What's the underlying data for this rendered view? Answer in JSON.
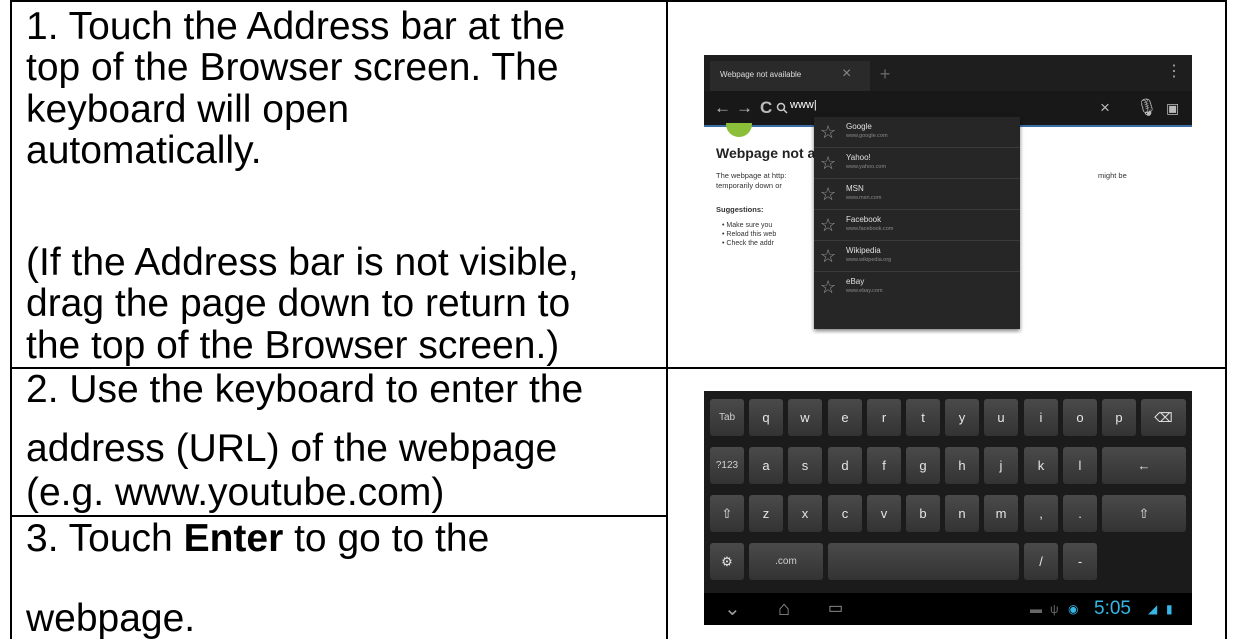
{
  "steps": [
    {
      "lines": [
        "1. Touch the Address bar at the",
        "top of the Browser screen. The",
        "keyboard will open",
        "automatically."
      ],
      "note_lines": [
        "(If the Address bar is not visible,",
        "drag the page down to return to",
        "the top of the Browser screen.)"
      ]
    },
    {
      "lines": [
        "2. Use the keyboard to enter the",
        "address (URL) of the webpage",
        "(e.g. www.youtube.com)"
      ]
    },
    {
      "prefix": "3. Touch ",
      "bold": "Enter",
      "suffix": " to go to the",
      "line2": "webpage."
    }
  ],
  "browser": {
    "tab_title": "Webpage not available",
    "address_value": "www|",
    "page_heading": "Webpage not a",
    "page_text_1": "The webpage at http:",
    "page_text_2": "temporarily down or",
    "page_text_right": "might be",
    "suggestions_label": "Suggestions:",
    "suggestion_bullets": [
      "Make sure you",
      "Reload this web",
      "Check the addr"
    ],
    "dropdown": [
      {
        "name": "Google",
        "url": "www.google.com"
      },
      {
        "name": "Yahoo!",
        "url": "www.yahoo.com"
      },
      {
        "name": "MSN",
        "url": "www.msn.com"
      },
      {
        "name": "Facebook",
        "url": "www.facebook.com"
      },
      {
        "name": "Wikipedia",
        "url": "www.wikipedia.org"
      },
      {
        "name": "eBay",
        "url": "www.ebay.com"
      }
    ]
  },
  "keyboard": {
    "row1": [
      "Tab",
      "q",
      "w",
      "e",
      "r",
      "t",
      "y",
      "u",
      "i",
      "o",
      "p",
      "⌫"
    ],
    "row2": [
      "?123",
      "a",
      "s",
      "d",
      "f",
      "g",
      "h",
      "j",
      "k",
      "l",
      "←"
    ],
    "row3": [
      "⇧",
      "z",
      "x",
      "c",
      "v",
      "b",
      "n",
      "m",
      ",",
      ".",
      "⇧"
    ],
    "row4": [
      "⚙",
      ".com",
      "",
      "/",
      "-"
    ],
    "time": "5:05"
  }
}
